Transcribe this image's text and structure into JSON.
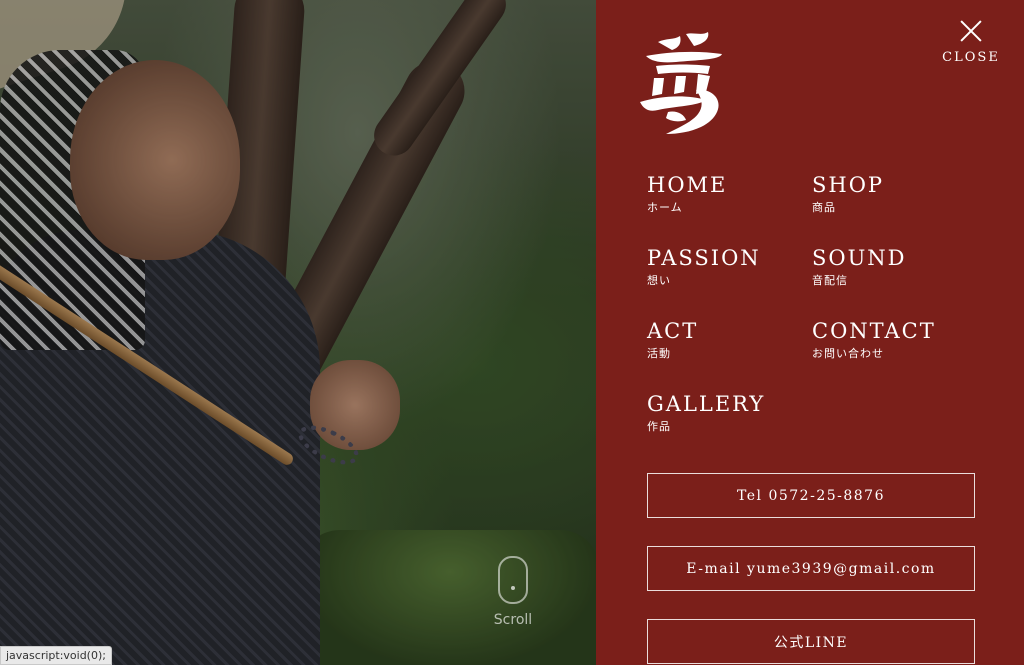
{
  "hero": {
    "scroll_label": "Scroll"
  },
  "status_bar": {
    "text": "javascript:void(0);"
  },
  "menu": {
    "logo_icon": "yume-calligraphy-logo",
    "close_label": "CLOSE",
    "items": [
      {
        "en": "HOME",
        "ja": "ホーム"
      },
      {
        "en": "SHOP",
        "ja": "商品"
      },
      {
        "en": "PASSION",
        "ja": "想い"
      },
      {
        "en": "SOUND",
        "ja": "音配信"
      },
      {
        "en": "ACT",
        "ja": "活動"
      },
      {
        "en": "CONTACT",
        "ja": "お問い合わせ"
      },
      {
        "en": "GALLERY",
        "ja": "作品"
      }
    ],
    "tel_label": "Tel 0572-25-8876",
    "email_label": "E-mail yume3939@gmail.com",
    "line_label": "公式LINE"
  },
  "colors": {
    "panel_bg": "#7b1f1a",
    "text": "#ffffff"
  }
}
